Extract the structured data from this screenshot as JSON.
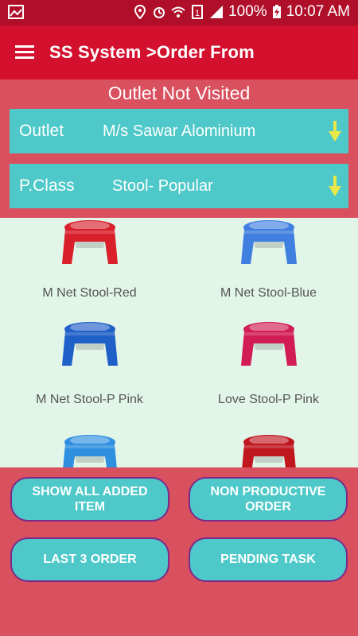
{
  "status_bar": {
    "battery": "100%",
    "time": "10:07 AM",
    "icons": [
      "image-icon",
      "location-icon",
      "alarm-icon",
      "wifi-icon",
      "sim-icon",
      "signal-icon",
      "battery-charging-icon"
    ]
  },
  "app_bar": {
    "title": "SS System >Order From",
    "menu_icon": "hamburger-menu-icon"
  },
  "header": {
    "visit_status": "Outlet Not Visited"
  },
  "outlet_selector": {
    "label": "Outlet",
    "value": "M/s Sawar Alominium",
    "arrow_icon": "dropdown-arrow-icon"
  },
  "pclass_selector": {
    "label": "P.Class",
    "value": "Stool- Popular",
    "arrow_icon": "dropdown-arrow-icon"
  },
  "products": [
    {
      "name": "M Net Stool-Red",
      "color": "#d81f2a"
    },
    {
      "name": "M Net Stool-Blue",
      "color": "#3f7fe0"
    },
    {
      "name": "M Net Stool-P Pink",
      "color": "#1f5fc8"
    },
    {
      "name": "Love Stool-P Pink",
      "color": "#d21c55"
    },
    {
      "name": "",
      "color": "#2f8fe0"
    },
    {
      "name": "",
      "color": "#c0161e"
    }
  ],
  "actions": {
    "show_all": "SHOW ALL ADDED ITEM",
    "non_productive": "NON PRODUCTIVE ORDER",
    "last_3": "LAST 3 ORDER",
    "pending": "PENDING TASK"
  },
  "colors": {
    "status_bar": "#b00f2a",
    "app_bar": "#d3112f",
    "panel": "#d9505f",
    "accent_teal": "#4ec8c8",
    "grid_bg": "#e2f5e9",
    "arrow": "#e8e84a",
    "button_border": "#7b2a8c"
  }
}
